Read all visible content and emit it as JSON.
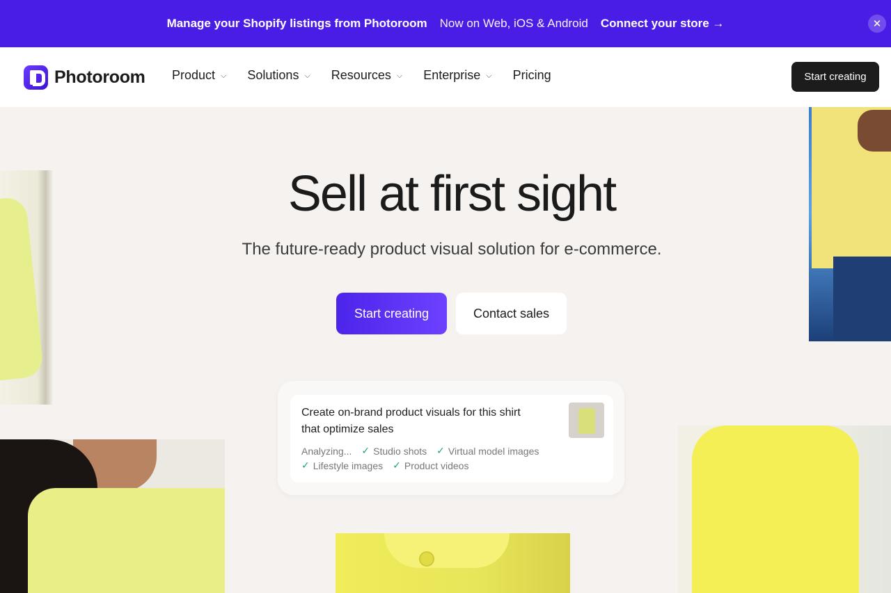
{
  "promo": {
    "message": "Manage your Shopify listings from Photoroom",
    "platforms": "Now on Web, iOS & Android",
    "link": "Connect your store →",
    "close_icon": "close-icon"
  },
  "header": {
    "logo_text": "Photoroom",
    "nav": [
      {
        "label": "Product",
        "has_dropdown": true
      },
      {
        "label": "Solutions",
        "has_dropdown": true
      },
      {
        "label": "Resources",
        "has_dropdown": true
      },
      {
        "label": "Enterprise",
        "has_dropdown": true
      },
      {
        "label": "Pricing",
        "has_dropdown": false
      }
    ],
    "cta": "Start creating"
  },
  "hero": {
    "title": "Sell at first sight",
    "subtitle": "The future-ready product visual solution for e-commerce.",
    "primary_button": "Start creating",
    "secondary_button": "Contact sales"
  },
  "prompt_card": {
    "text": "Create on-brand product visuals for this shirt that optimize sales",
    "status_analyzing": "Analyzing...",
    "steps": [
      "Studio shots",
      "Virtual model images",
      "Lifestyle images",
      "Product videos"
    ]
  },
  "colors": {
    "promo_bg": "#4a1de6",
    "brand_purple": "#5a30f0",
    "page_bg": "#f5f2ef",
    "dark_button": "#1c1c1c",
    "check_green": "#1ba66b"
  }
}
